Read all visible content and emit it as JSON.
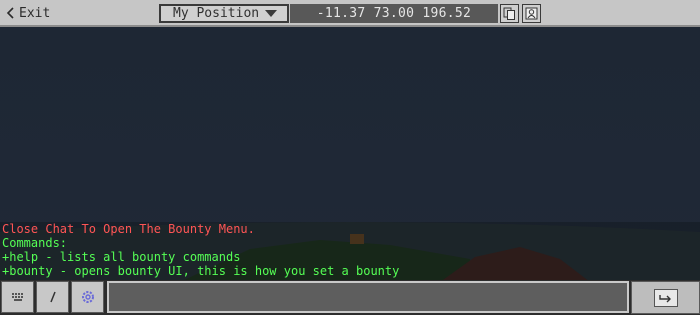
{
  "topbar": {
    "exit_label": "Exit",
    "position_dropdown": {
      "selected": "My Position"
    },
    "coordinates": "-11.37 73.00 196.52"
  },
  "chat": {
    "lines": [
      {
        "text": "Close Chat To Open The Bounty Menu.",
        "color": "#ff5555"
      },
      {
        "text": "Commands:",
        "color": "#55ff55"
      },
      {
        "text": "+help - lists all bounty commands",
        "color": "#55ff55"
      },
      {
        "text": "+bounty - opens bounty UI, this is how you set a bounty",
        "color": "#55ff55"
      }
    ],
    "input_value": ""
  },
  "icons": {
    "exit": "chevron-left-icon",
    "dropdown": "chevron-down-icon",
    "copy": "copy-icon",
    "teleport": "teleport-icon",
    "keyboard": "keyboard-icon",
    "slash": "slash-command-icon",
    "settings": "settings-icon",
    "send": "send-icon"
  },
  "colors": {
    "chat_red": "#ff5555",
    "chat_green": "#55ff55"
  }
}
